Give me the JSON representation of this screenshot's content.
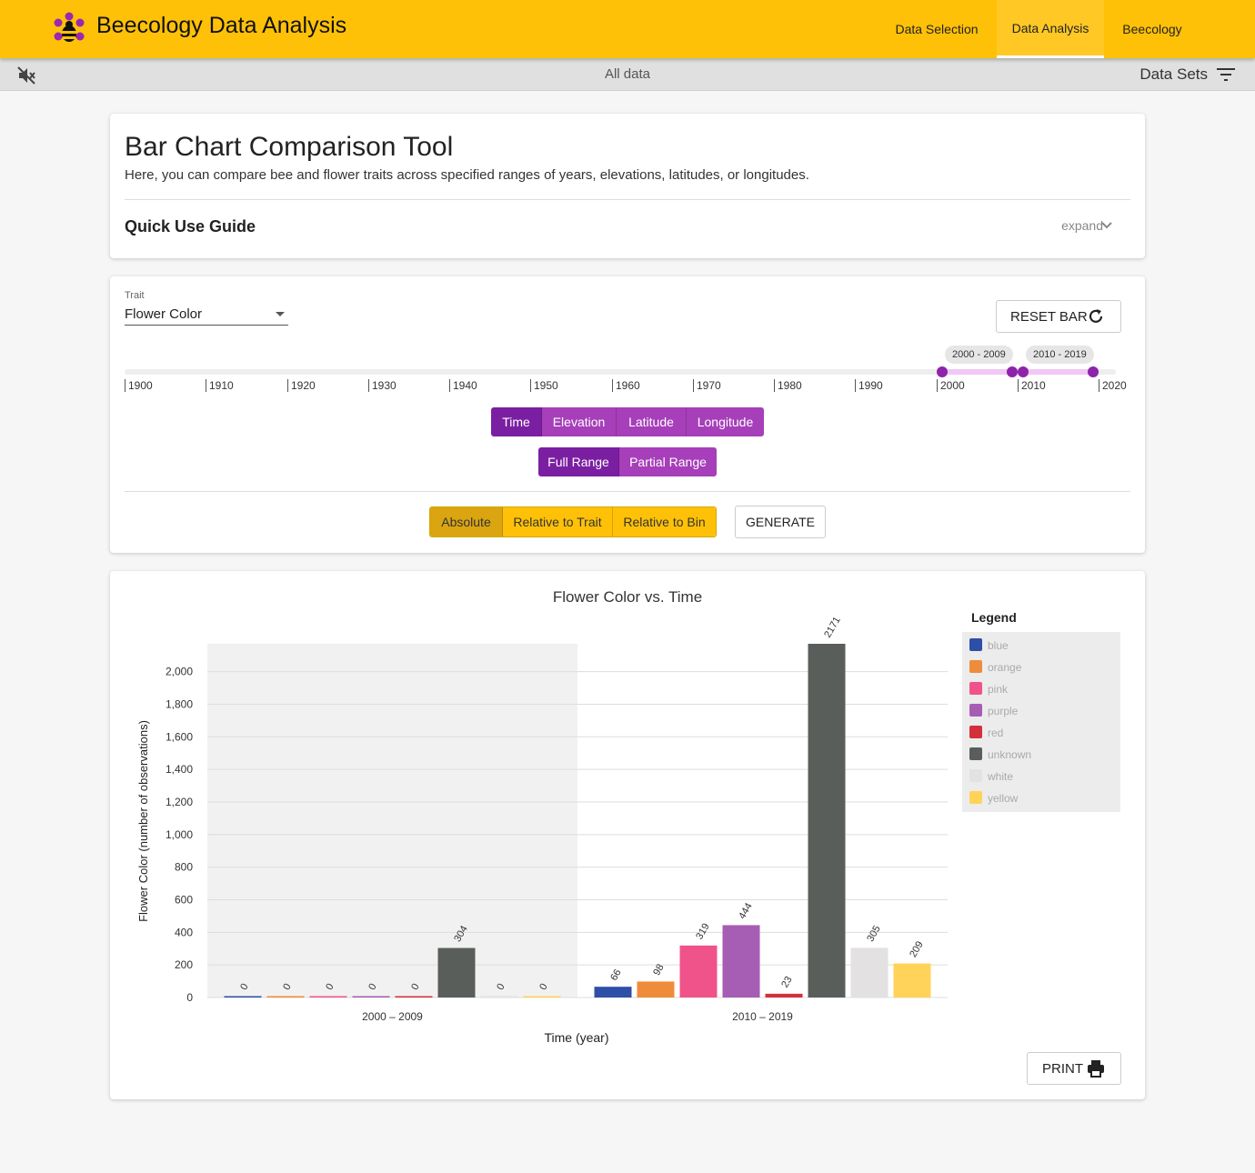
{
  "app": {
    "title": "Beecology Data Analysis"
  },
  "nav": {
    "items": [
      "Data Selection",
      "Data Analysis",
      "Beecology"
    ],
    "active": "Data Analysis"
  },
  "subbar": {
    "center_label": "All data",
    "datasets_label": "Data Sets"
  },
  "intro": {
    "title": "Bar Chart Comparison Tool",
    "description": "Here, you can compare bee and flower traits across specified ranges of years, elevations, latitudes, or longitudes.",
    "guide_title": "Quick Use Guide",
    "expand_label": "expand"
  },
  "controls": {
    "trait_label": "Trait",
    "trait_value": "Flower Color",
    "reset_label": "RESET BAR",
    "ticks": [
      "1900",
      "1910",
      "1920",
      "1930",
      "1940",
      "1950",
      "1960",
      "1970",
      "1980",
      "1990",
      "2000",
      "2010",
      "2020"
    ],
    "range_tags": [
      "2000 - 2009",
      "2010 - 2019"
    ],
    "dimension_buttons": [
      "Time",
      "Elevation",
      "Latitude",
      "Longitude"
    ],
    "range_buttons": [
      "Full Range",
      "Partial Range"
    ],
    "mode_buttons": [
      "Absolute",
      "Relative to Trait",
      "Relative to Bin"
    ],
    "generate_label": "GENERATE"
  },
  "print_label": "PRINT",
  "colors": {
    "accent": "#ffc107",
    "purple": "#a63fb9",
    "purple_active": "#7b1fa2",
    "blue": "#2e4fa8",
    "orange": "#ef8c3b",
    "pink": "#f0538a",
    "purple_bar": "#a65db4",
    "red": "#d32f3c",
    "unknown": "#5a5e5b",
    "white": "#e3e1e2",
    "yellow": "#ffd35a"
  },
  "chart_data": {
    "type": "bar",
    "title": "Flower Color vs. Time",
    "xlabel": "Time (year)",
    "ylabel": "Flower Color (number of observations)",
    "categories": [
      "2000 – 2009",
      "2010 – 2019"
    ],
    "ylim": [
      0,
      2171
    ],
    "yticks": [
      "0",
      "200",
      "400",
      "600",
      "800",
      "1,000",
      "1,200",
      "1,400",
      "1,600",
      "1,800",
      "2,000"
    ],
    "legend_title": "Legend",
    "legend_position": "right",
    "grid": true,
    "series": [
      {
        "name": "blue",
        "values": [
          0,
          66
        ]
      },
      {
        "name": "orange",
        "values": [
          0,
          98
        ]
      },
      {
        "name": "pink",
        "values": [
          0,
          319
        ]
      },
      {
        "name": "purple",
        "values": [
          0,
          444
        ]
      },
      {
        "name": "red",
        "values": [
          0,
          23
        ]
      },
      {
        "name": "unknown",
        "values": [
          304,
          2171
        ]
      },
      {
        "name": "white",
        "values": [
          0,
          305
        ]
      },
      {
        "name": "yellow",
        "values": [
          0,
          209
        ]
      }
    ]
  }
}
